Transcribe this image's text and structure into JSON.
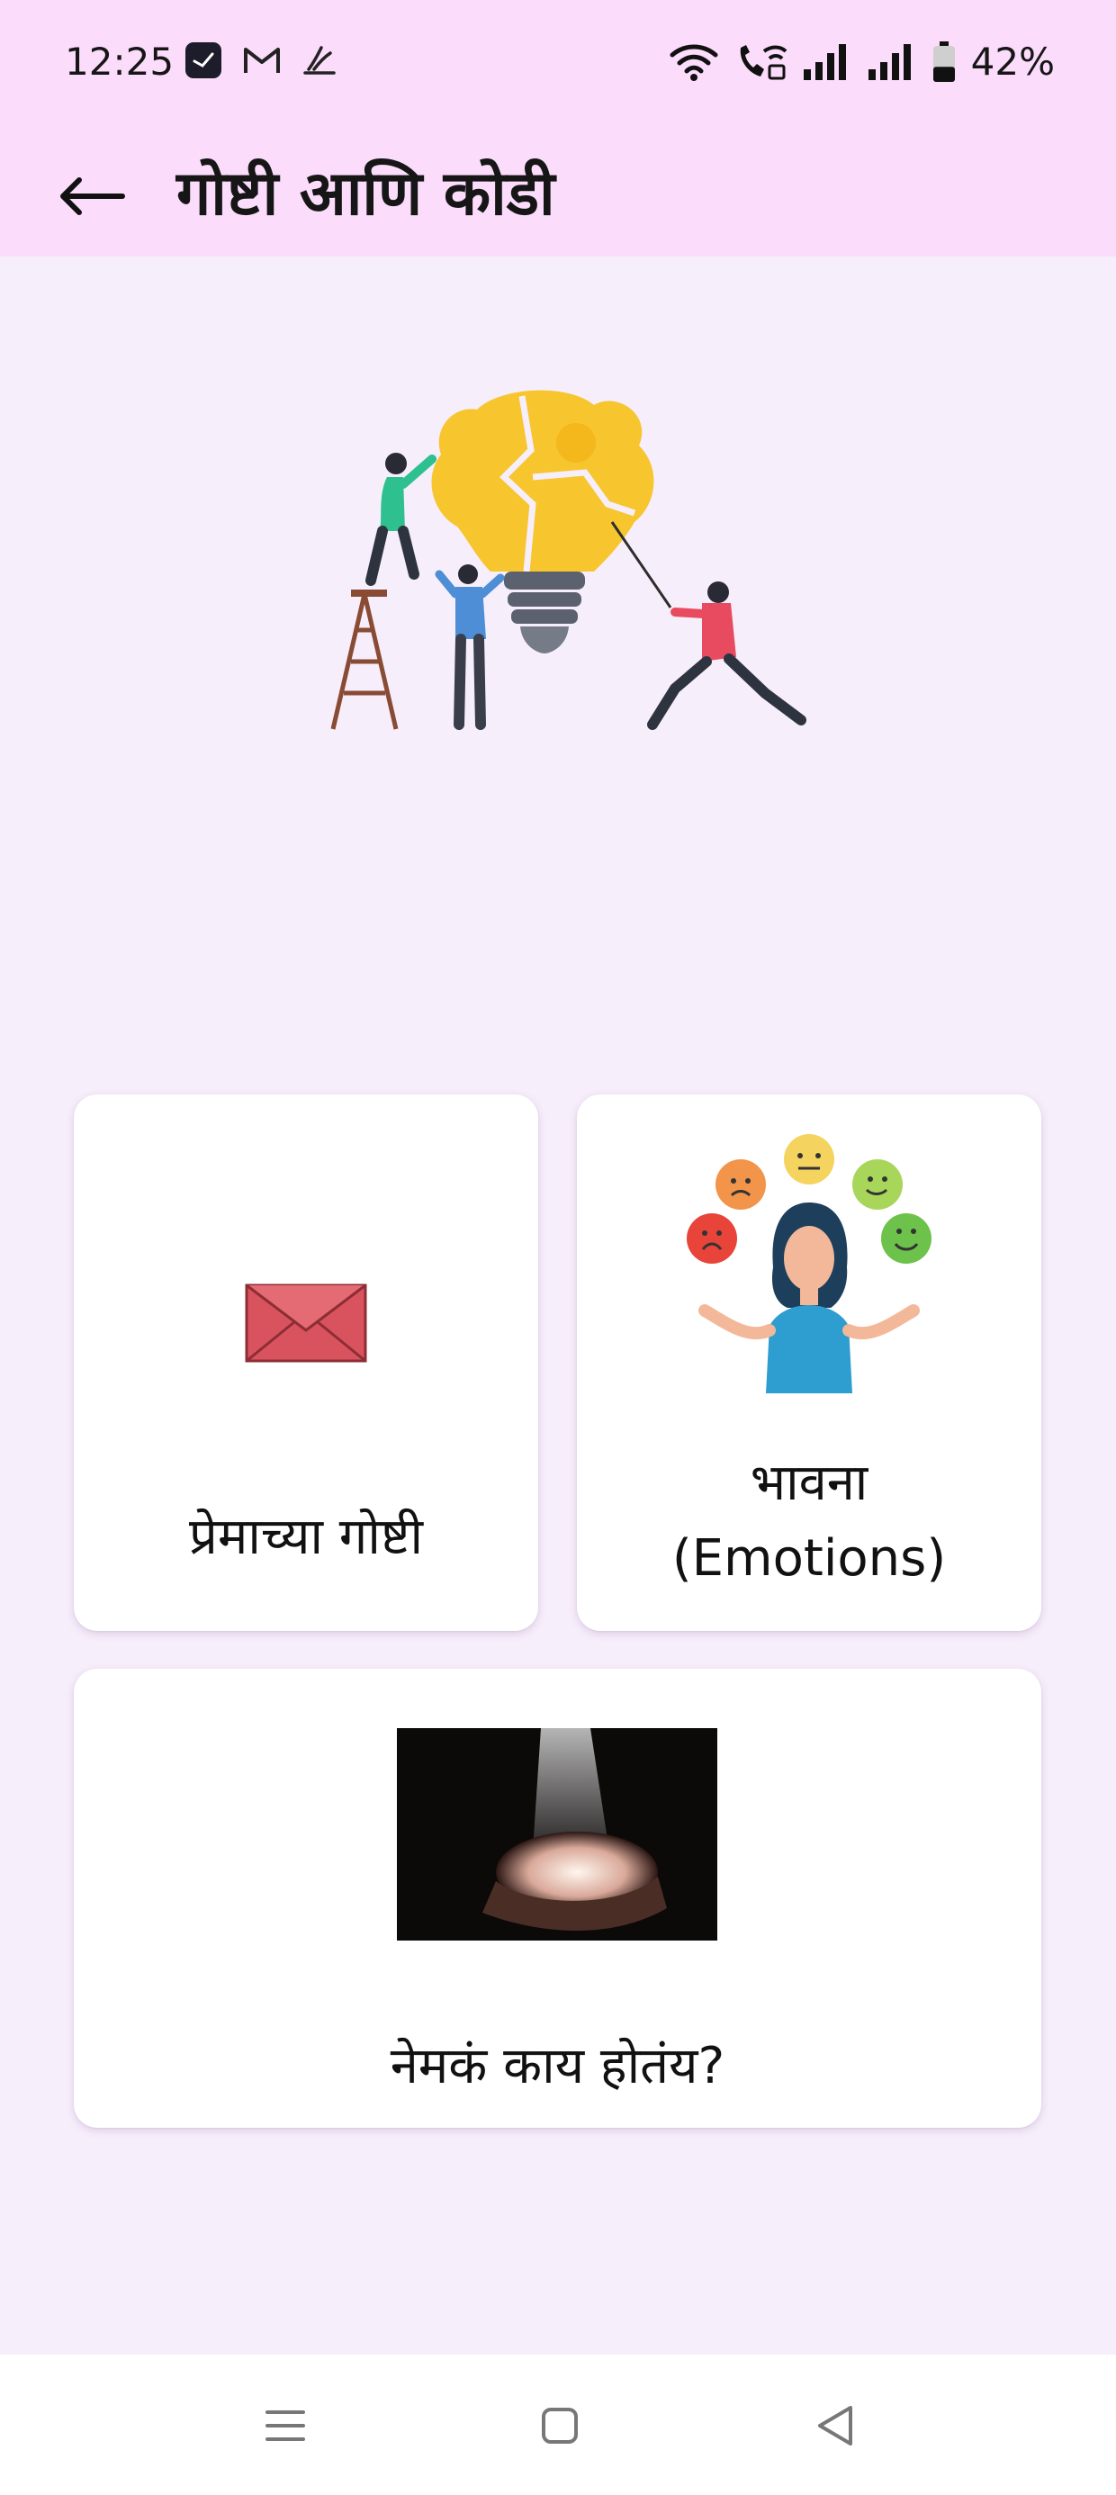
{
  "status_bar": {
    "time": "12:25",
    "battery_text": "42%",
    "battery_level": 0.42,
    "icons": [
      "clock-app-icon",
      "gmail-icon",
      "fitness-app-icon",
      "wifi-icon",
      "wifi-calling-icon",
      "signal-icon",
      "signal-icon",
      "battery-icon"
    ]
  },
  "app_bar": {
    "back_icon": "arrow-left-icon",
    "title": "गोष्टी आणि कोडी"
  },
  "hero": {
    "image": "puzzle-lightbulb-teamwork-illustration"
  },
  "cards": {
    "love": {
      "label": "प्रेमाच्या गोष्टी",
      "image": "envelope-icon"
    },
    "emotions": {
      "label_line1": "भावना",
      "label_line2": "(Emotions)",
      "image": "emotions-woman-illustration"
    },
    "happening": {
      "label": "नेमकं काय होतंय?",
      "image": "hands-in-light-photo"
    }
  },
  "colors": {
    "app_bar": "#fbdcfb",
    "background": "#f7eefb",
    "card": "#ffffff"
  },
  "nav_bar": {
    "icons": [
      "menu-icon",
      "home-square-icon",
      "back-triangle-icon"
    ]
  }
}
